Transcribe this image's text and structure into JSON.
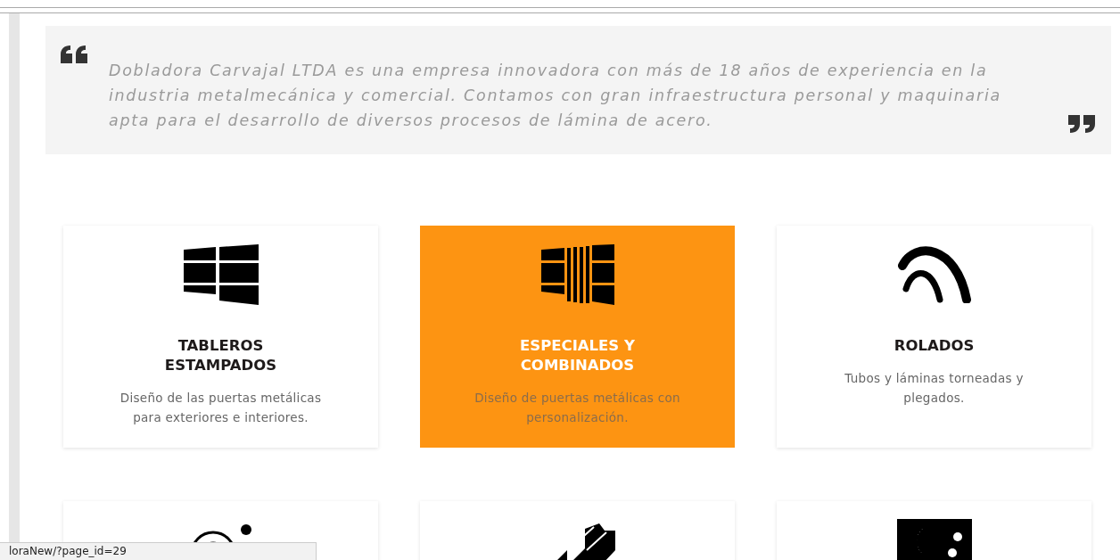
{
  "quote": {
    "text": "Dobladora Carvajal LTDA es una empresa innovadora con más de 18 años de experiencia en la industria metalmecánica y comercial. Contamos con gran infraestructura personal y maquinaria apta para el desarrollo de diversos procesos de lámina de acero."
  },
  "cards": [
    {
      "title": "TABLEROS ESTAMPADOS",
      "description": "Diseño de las puertas metálicas para exteriores e interiores.",
      "highlighted": false
    },
    {
      "title": "ESPECIALES Y COMBINADOS",
      "description": "Diseño de puertas metálicas con personalización.",
      "highlighted": true
    },
    {
      "title": "ROLADOS",
      "description": "Tubos y láminas torneadas y plegados.",
      "highlighted": false
    },
    {
      "highlighted": false
    },
    {
      "highlighted": false
    },
    {
      "highlighted": false
    }
  ],
  "status_bar": {
    "url": "loraNew/?page_id=29"
  }
}
